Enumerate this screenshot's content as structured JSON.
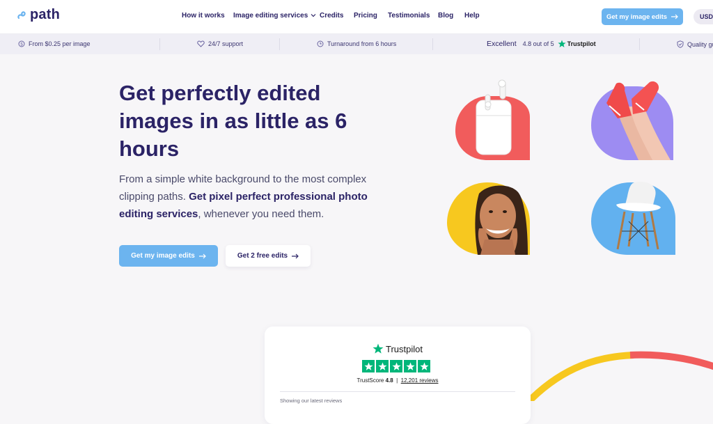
{
  "header": {
    "logo_text": "path",
    "nav": [
      {
        "label": "How it works"
      },
      {
        "label": "Image editing services"
      },
      {
        "label": "Credits"
      },
      {
        "label": "Pricing"
      },
      {
        "label": "Testimonials"
      },
      {
        "label": "Blog"
      },
      {
        "label": "Help"
      }
    ],
    "cta_label": "Get my image edits",
    "currency": "USD"
  },
  "infobar": {
    "price": "From $0.25 per image",
    "support": "24/7 support",
    "turnaround": "Turnaround from 6 hours",
    "tp_excellent": "Excellent",
    "tp_score": "4.8 out of 5",
    "tp_brand": "Trustpilot",
    "quality": "Quality guaranteed"
  },
  "hero": {
    "title": "Get perfectly edited images in as little as 6 hours",
    "sub_plain_1": "From a simple white background to the most complex clipping paths. ",
    "sub_bold": "Get pixel perfect professional photo editing services",
    "sub_plain_2": ", whenever you need them.",
    "primary_button": "Get my image edits",
    "secondary_button": "Get 2 free edits"
  },
  "trustpilot_card": {
    "brand": "Trustpilot",
    "trustscore_label": "TrustScore",
    "trustscore_value": "4.8",
    "separator": "|",
    "reviews": "12,201 reviews",
    "showing": "Showing our latest reviews"
  },
  "colors": {
    "brand_navy": "#2b2366",
    "accent_blue": "#6cb4ef",
    "trustpilot_green": "#00b67a",
    "tile_red": "#f15c5c",
    "tile_purple": "#9d8cf2",
    "tile_yellow": "#f7c81f",
    "tile_blue": "#62b1ef"
  }
}
